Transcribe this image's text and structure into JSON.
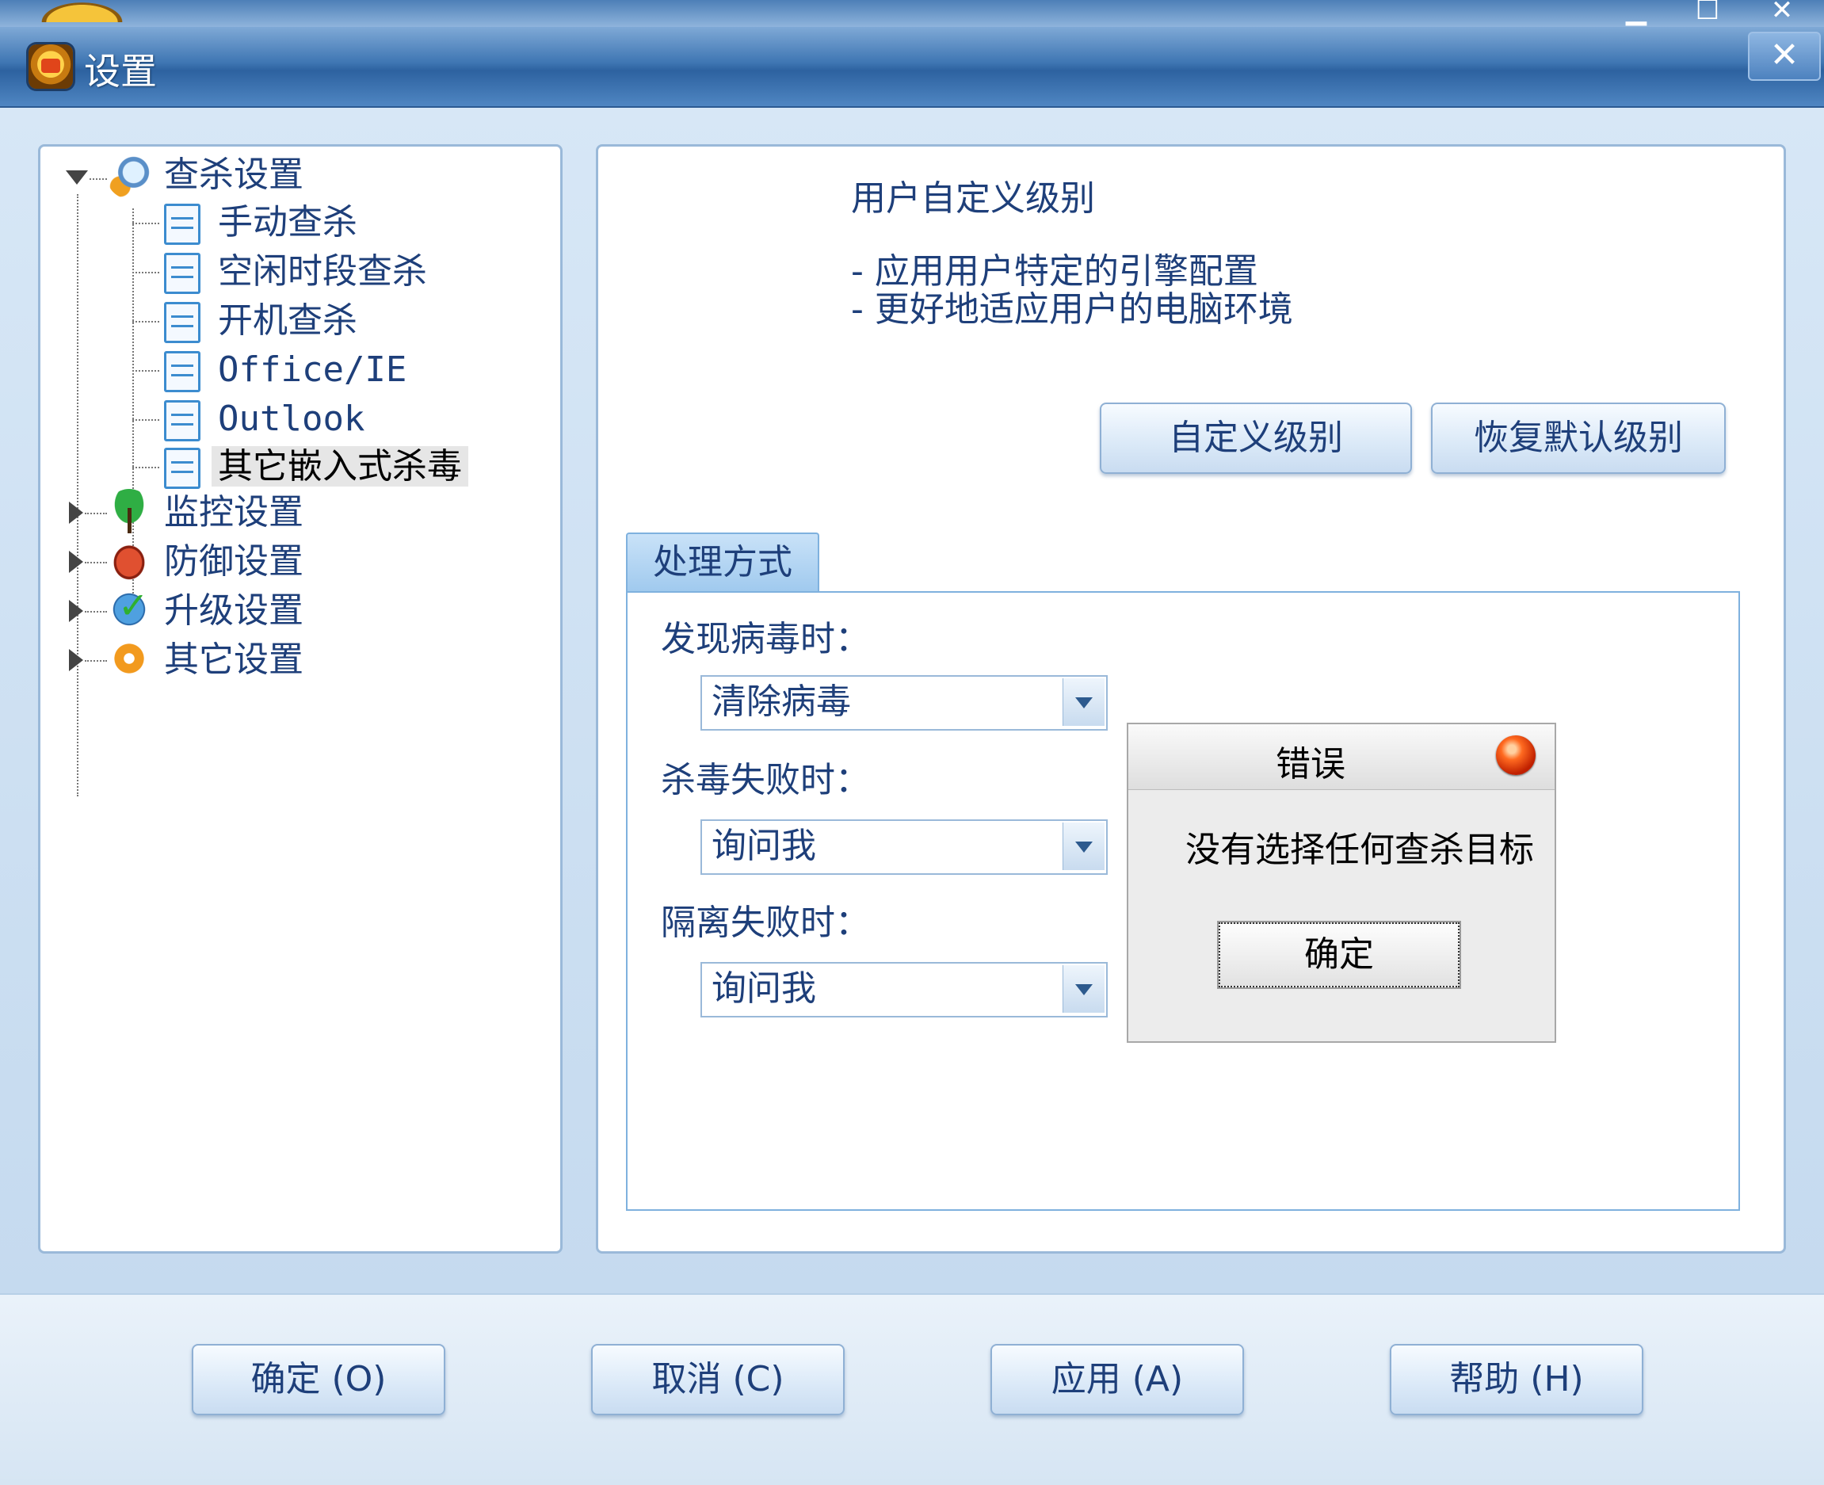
{
  "window": {
    "title": "设置",
    "close_glyph": "✕",
    "parent_controls": [
      "▁",
      "☐",
      "✕"
    ]
  },
  "tree": {
    "groups": [
      {
        "label": "查杀设置",
        "icon": "scan-settings-icon",
        "expanded": true,
        "children": [
          "手动查杀",
          "空闲时段查杀",
          "开机查杀",
          "Office/IE",
          "Outlook",
          "其它嵌入式杀毒"
        ],
        "selected_child": "其它嵌入式杀毒"
      },
      {
        "label": "监控设置",
        "icon": "umbrella-icon",
        "expanded": false
      },
      {
        "label": "防御设置",
        "icon": "glove-icon",
        "expanded": false
      },
      {
        "label": "升级设置",
        "icon": "globe-check-icon",
        "expanded": false
      },
      {
        "label": "其它设置",
        "icon": "gear-icon",
        "expanded": false
      }
    ]
  },
  "content": {
    "level_title": "用户自定义级别",
    "bullets": [
      "-  应用用户特定的引擎配置",
      "-  更好地适应用户的电脑环境"
    ],
    "custom_level_button": "自定义级别",
    "restore_default_button": "恢复默认级别",
    "tab_label": "处理方式",
    "fields": [
      {
        "label": "发现病毒时：",
        "value": "清除病毒"
      },
      {
        "label": "杀毒失败时：",
        "value": "询问我"
      },
      {
        "label": "隔离失败时：",
        "value": "询问我"
      }
    ]
  },
  "error_popup": {
    "title": "错误",
    "message": "没有选择任何查杀目标",
    "ok_button": "确定"
  },
  "footer": {
    "ok": "确定 (O)",
    "cancel": "取消 (C)",
    "apply": "应用 (A)",
    "help": "帮助 (H)"
  },
  "colors": {
    "title_bar": "#3f76b3",
    "panel_border": "#9ab9d9",
    "text_blue": "#1e3f7a",
    "background": "#c9dcef"
  }
}
